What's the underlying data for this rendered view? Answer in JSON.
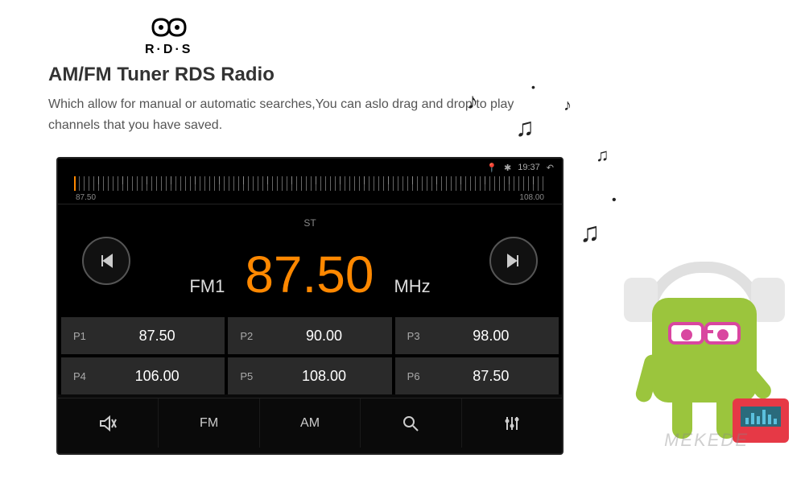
{
  "header": {
    "rds_label": "R·D·S",
    "title": "AM/FM Tuner RDS Radio",
    "description": "Which allow for manual or automatic searches,You can aslo drag and drop to play channels that you have saved."
  },
  "status": {
    "time": "19:37"
  },
  "tuner": {
    "scale_min": "87.50",
    "scale_max": "108.00",
    "st": "ST",
    "band": "FM1",
    "frequency": "87.50",
    "unit": "MHz"
  },
  "presets": [
    {
      "label": "P1",
      "freq": "87.50"
    },
    {
      "label": "P2",
      "freq": "90.00"
    },
    {
      "label": "P3",
      "freq": "98.00"
    },
    {
      "label": "P4",
      "freq": "106.00"
    },
    {
      "label": "P5",
      "freq": "108.00"
    },
    {
      "label": "P6",
      "freq": "87.50"
    }
  ],
  "bottom": {
    "fm": "FM",
    "am": "AM"
  },
  "watermark": "MEKEDE"
}
